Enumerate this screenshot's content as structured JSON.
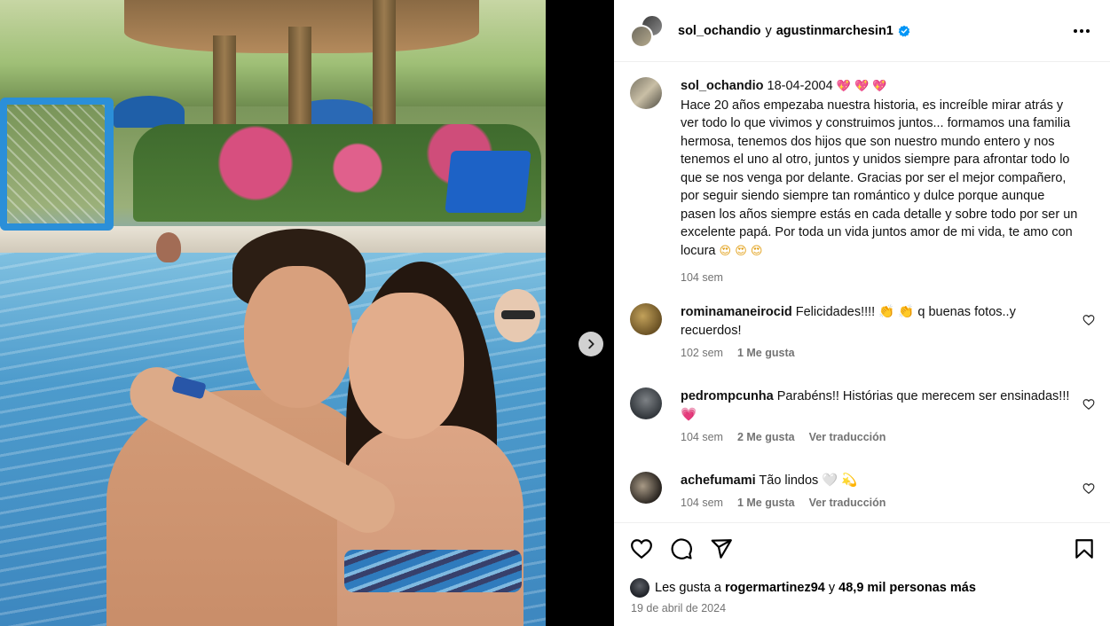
{
  "post": {
    "header": {
      "user1": "sol_ochandio",
      "joiner": "y",
      "user2": "agustinmarchesin1",
      "verified": true
    },
    "caption": {
      "user": "sol_ochandio",
      "date_line": "18-04-2004",
      "emoji_after_date": "💖 💖 💖",
      "text": "Hace 20 años empezaba nuestra historia, es increíble mirar atrás y ver todo lo que vivimos y construimos juntos... formamos una familia hermosa, tenemos dos hijos que son nuestro mundo entero y nos tenemos el uno al otro, juntos y unidos siempre para afrontar todo lo que se nos venga por delante. Gracias por ser el mejor compañero, por seguir siendo siempre tan romántico y dulce porque aunque pasen los años siempre estás en cada detalle y sobre todo por ser un excelente papá. Por toda un vida juntos amor de mi vida, te amo con locura",
      "emoji_end": "😍 😍 😍",
      "time": "104 sem"
    },
    "comments": [
      {
        "user": "rominamaneirocid",
        "text": "Felicidades!!!! 👏 👏 q buenas fotos..y recuerdos!",
        "time": "102 sem",
        "likes": "1 Me gusta",
        "translate": ""
      },
      {
        "user": "pedrompcunha",
        "text": "Parabéns!! Histórias que merecem ser ensinadas!!! 💗",
        "time": "104 sem",
        "likes": "2 Me gusta",
        "translate": "Ver traducción"
      },
      {
        "user": "achefumami",
        "text": "Tão lindos 🤍 💫",
        "time": "104 sem",
        "likes": "1 Me gusta",
        "translate": "Ver traducción"
      }
    ],
    "likes": {
      "prefix": "Les gusta a",
      "user": "rogermartinez94",
      "joiner": "y",
      "others": "48,9 mil personas más"
    },
    "date": "19 de abril de 2024"
  },
  "icons": {
    "like": "heart-icon",
    "comment": "comment-icon",
    "share": "share-icon",
    "save": "bookmark-icon",
    "more": "more-icon",
    "next": "chevron-right-icon",
    "verified": "verified-badge-icon"
  },
  "colors": {
    "verified": "#0095f6",
    "muted": "#737373",
    "heart_emoji": "#e6336f"
  }
}
